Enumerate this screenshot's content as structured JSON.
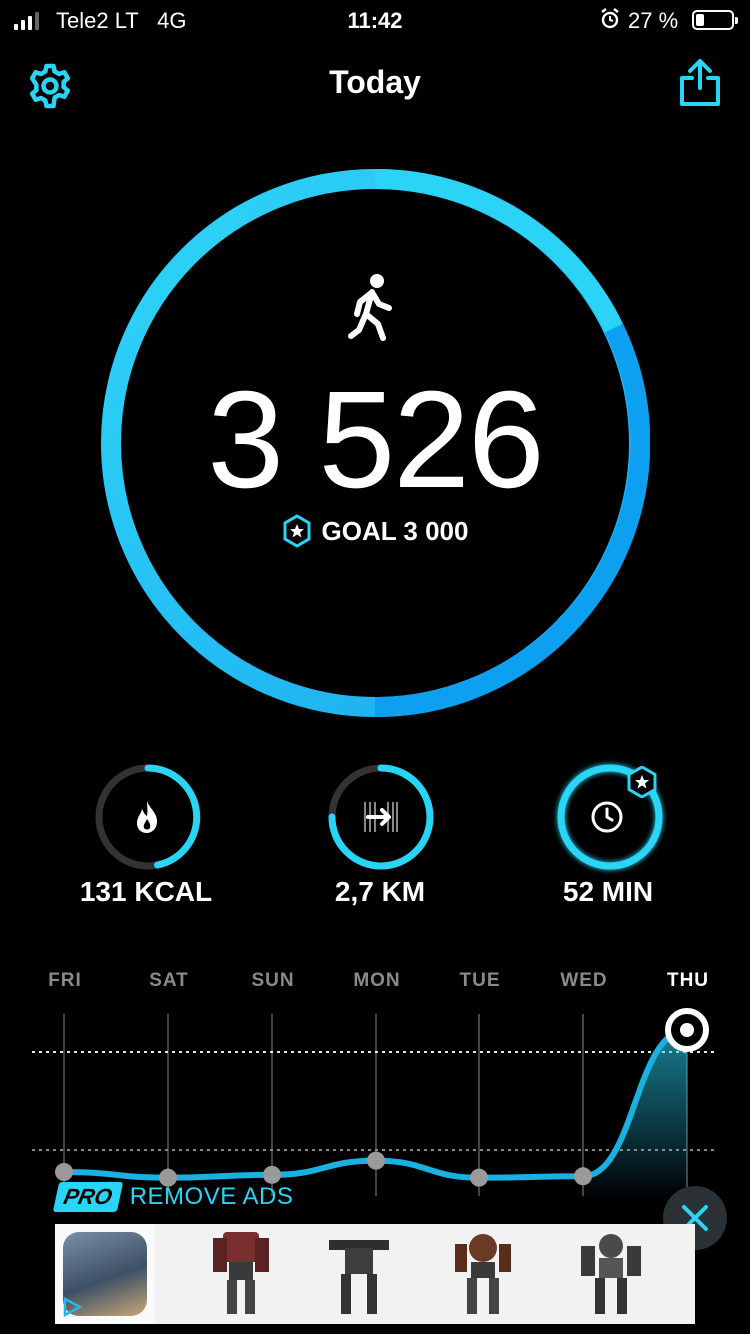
{
  "status_bar": {
    "carrier": "Tele2 LT",
    "network": "4G",
    "time": "11:42",
    "battery_percent": "27 %"
  },
  "header": {
    "title": "Today",
    "settings_icon": "gear-icon",
    "share_icon": "share-icon"
  },
  "steps": {
    "count": "3 526",
    "goal_label": "GOAL 3 000",
    "progress": 1.0
  },
  "stats": [
    {
      "label": "131 KCAL",
      "icon": "flame-icon",
      "progress": 0.42
    },
    {
      "label": "2,7 KM",
      "icon": "distance-icon",
      "progress": 0.75
    },
    {
      "label": "52 MIN",
      "icon": "clock-icon",
      "progress": 1.0
    }
  ],
  "week": {
    "days": [
      "FRI",
      "SAT",
      "SUN",
      "MON",
      "TUE",
      "WED",
      "THU"
    ],
    "active_day": "THU",
    "relative_steps": [
      0.0,
      -0.04,
      -0.02,
      0.08,
      -0.04,
      -0.03,
      1.0
    ]
  },
  "promo": {
    "pro_badge": "PRO",
    "remove_ads": "REMOVE ADS"
  },
  "colors": {
    "accent": "#29d5f5",
    "ring_dark": "#0aa3f0",
    "track": "#333333"
  }
}
